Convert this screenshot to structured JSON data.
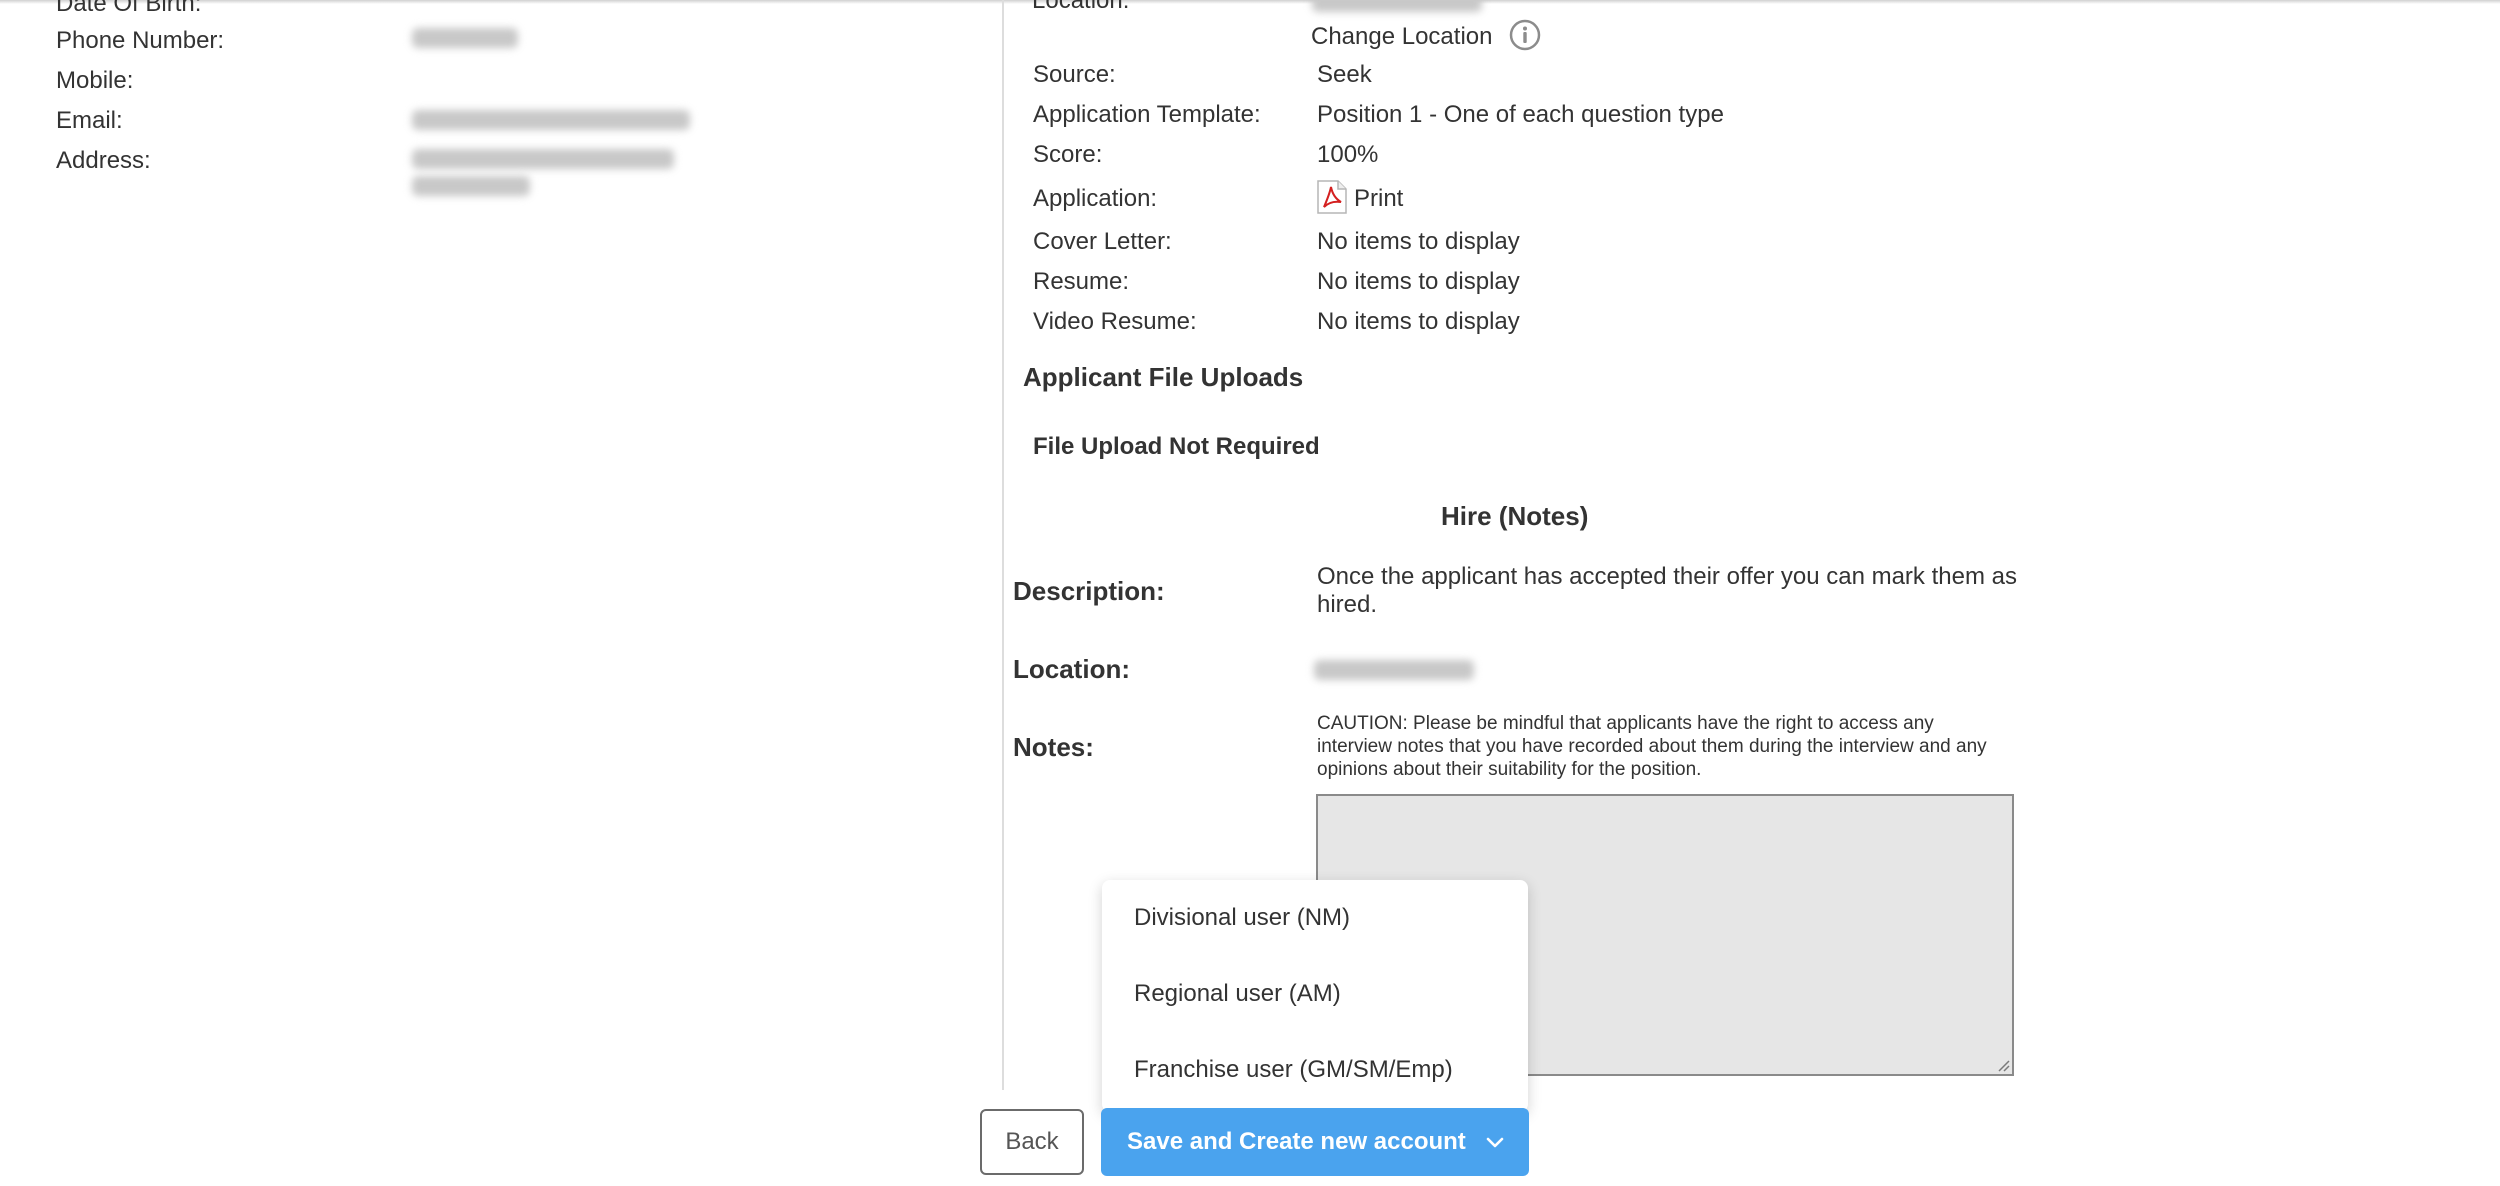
{
  "applicant": {
    "dob_label": "Date Of Birth:",
    "phone_label": "Phone Number:",
    "mobile_label": "Mobile:",
    "email_label": "Email:",
    "address_label": "Address:"
  },
  "details": {
    "location_label": "Location:",
    "change_location": "Change Location",
    "source_label": "Source:",
    "source_value": "Seek",
    "template_label": "Application Template:",
    "template_value": "Position 1 - One of each question type",
    "score_label": "Score:",
    "score_value": "100%",
    "application_label": "Application:",
    "print_label": "Print",
    "cover_letter_label": "Cover Letter:",
    "cover_letter_value": "No items to display",
    "resume_label": "Resume:",
    "resume_value": "No items to display",
    "video_resume_label": "Video Resume:",
    "video_resume_value": "No items to display"
  },
  "uploads": {
    "heading": "Applicant File Uploads",
    "status": "File Upload Not Required"
  },
  "hire": {
    "heading": "Hire (Notes)",
    "description_label": "Description:",
    "description_line1": "Once the applicant has accepted their offer you can mark them as",
    "description_line2": "hired.",
    "location_label": "Location:",
    "notes_label": "Notes:",
    "caution_line1": "CAUTION: Please be mindful that applicants have the right to access any",
    "caution_line2": "interview notes that you have recorded about them during the interview and any",
    "caution_line3": "opinions about their suitability for the position."
  },
  "dropdown": {
    "items": [
      "Divisional user (NM)",
      "Regional user (AM)",
      "Franchise user (GM/SM/Emp)"
    ]
  },
  "buttons": {
    "back": "Back",
    "save": "Save and Create new account"
  },
  "colors": {
    "primary_button": "#4aa3ee",
    "text": "#333333"
  }
}
